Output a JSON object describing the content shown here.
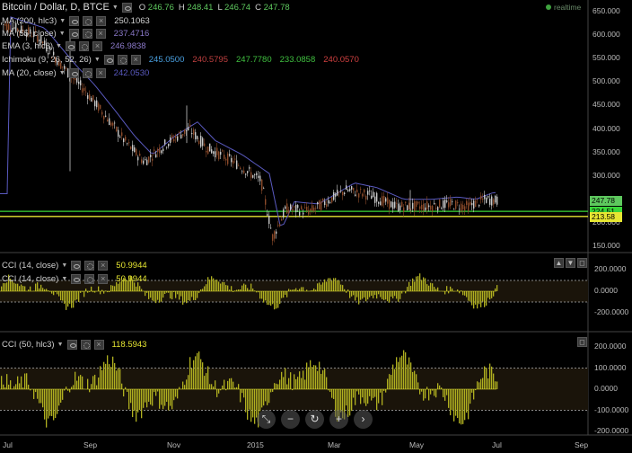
{
  "header": {
    "title": "Bitcoin / Dollar, D, BTCE",
    "ohlc": [
      {
        "k": "O",
        "v": "246.76"
      },
      {
        "k": "H",
        "v": "248.41"
      },
      {
        "k": "L",
        "v": "246.74"
      },
      {
        "k": "C",
        "v": "247.78"
      }
    ],
    "realtime": "realtime"
  },
  "indicators": [
    {
      "label": "MA (200, hlc3)",
      "value": "250.1063",
      "color": "#d0d0d0"
    },
    {
      "label": "MA (55, close)",
      "value": "237.4716",
      "color": "#8a78c8"
    },
    {
      "label": "EMA (3, hlc3)",
      "value": "246.9838",
      "color": "#8a78c8"
    },
    {
      "label": "Ichimoku (9, 26, 52, 26)",
      "values": [
        {
          "v": "245.0500",
          "color": "#4aa0e0"
        },
        {
          "v": "240.5795",
          "color": "#c04040"
        },
        {
          "v": "247.7780",
          "color": "#40c040"
        },
        {
          "v": "233.0858",
          "color": "#40c040"
        },
        {
          "v": "240.0570",
          "color": "#d04040"
        }
      ]
    },
    {
      "label": "MA (20, close)",
      "value": "242.0530",
      "color": "#5a5ac0"
    }
  ],
  "cci_panes": [
    {
      "rows": [
        {
          "label": "CCI (14, close)",
          "value": "50.9944"
        },
        {
          "label": "CCI (14, close)",
          "value": "50.9944"
        }
      ]
    },
    {
      "rows": [
        {
          "label": "CCI (50, hlc3)",
          "value": "118.5943"
        }
      ]
    }
  ],
  "price_axis": {
    "ticks": [
      "650.000",
      "600.000",
      "550.000",
      "500.000",
      "450.000",
      "400.000",
      "350.000",
      "300.000",
      "250.000",
      "200.000",
      "150.000"
    ],
    "tags": [
      {
        "text": "247.78",
        "color": "#5ec85e"
      },
      {
        "text": "224.51",
        "color": "#39d839"
      },
      {
        "text": "213.58",
        "color": "#e6e632"
      }
    ]
  },
  "cci_axis_1": {
    "ticks": [
      "200.0000",
      "0.0000",
      "-200.0000"
    ]
  },
  "cci_axis_2": {
    "ticks": [
      "200.0000",
      "100.0000",
      "0.0000",
      "-100.0000",
      "-200.0000"
    ]
  },
  "time_axis": {
    "labels": [
      "Jul",
      "Sep",
      "Nov",
      "2015",
      "Mar",
      "May",
      "Jul",
      "Sep"
    ]
  },
  "zoom_controls": [
    "⤡",
    "−",
    "↻",
    "+",
    "›"
  ],
  "colors": {
    "background": "#000000",
    "candle_up": "#c8c8c8",
    "candle_down": "#8b4a2a",
    "support_green": "#39d839",
    "support_yellow": "#e6e632",
    "cci_fill": "#b0b020"
  }
}
